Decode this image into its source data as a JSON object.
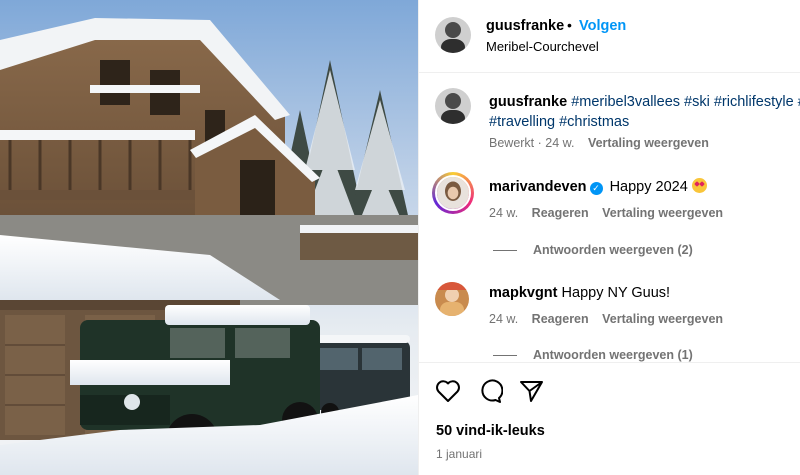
{
  "header": {
    "username": "guusfranke",
    "separator": "•",
    "follow_label": "Volgen",
    "location": "Meribel-Courchevel"
  },
  "caption": {
    "username": "guusfranke",
    "hashtags_line1": "#meribel3vallees #ski #richlifestyle #",
    "hashtags_line2": "#travelling #christmas",
    "edited": "Bewerkt",
    "time": "24 w.",
    "translate": "Vertaling weergeven"
  },
  "comments": [
    {
      "username": "marivandeven",
      "verified": true,
      "text": "Happy 2024",
      "time": "24 w.",
      "reply": "Reageren",
      "translate": "Vertaling weergeven",
      "view_replies": "Antwoorden weergeven (2)"
    },
    {
      "username": "mapkvgnt",
      "verified": false,
      "text": "Happy NY Guus!",
      "time": "24 w.",
      "reply": "Reageren",
      "translate": "Vertaling weergeven",
      "view_replies": "Antwoorden weergeven (1)"
    }
  ],
  "actions": {
    "icons": [
      "heart-icon",
      "comment-icon",
      "share-icon"
    ],
    "likes": "50 vind-ik-leuks",
    "date": "1 januari"
  },
  "colors": {
    "accent": "#0095f6",
    "hashtag": "#00376b",
    "muted": "#737373"
  }
}
